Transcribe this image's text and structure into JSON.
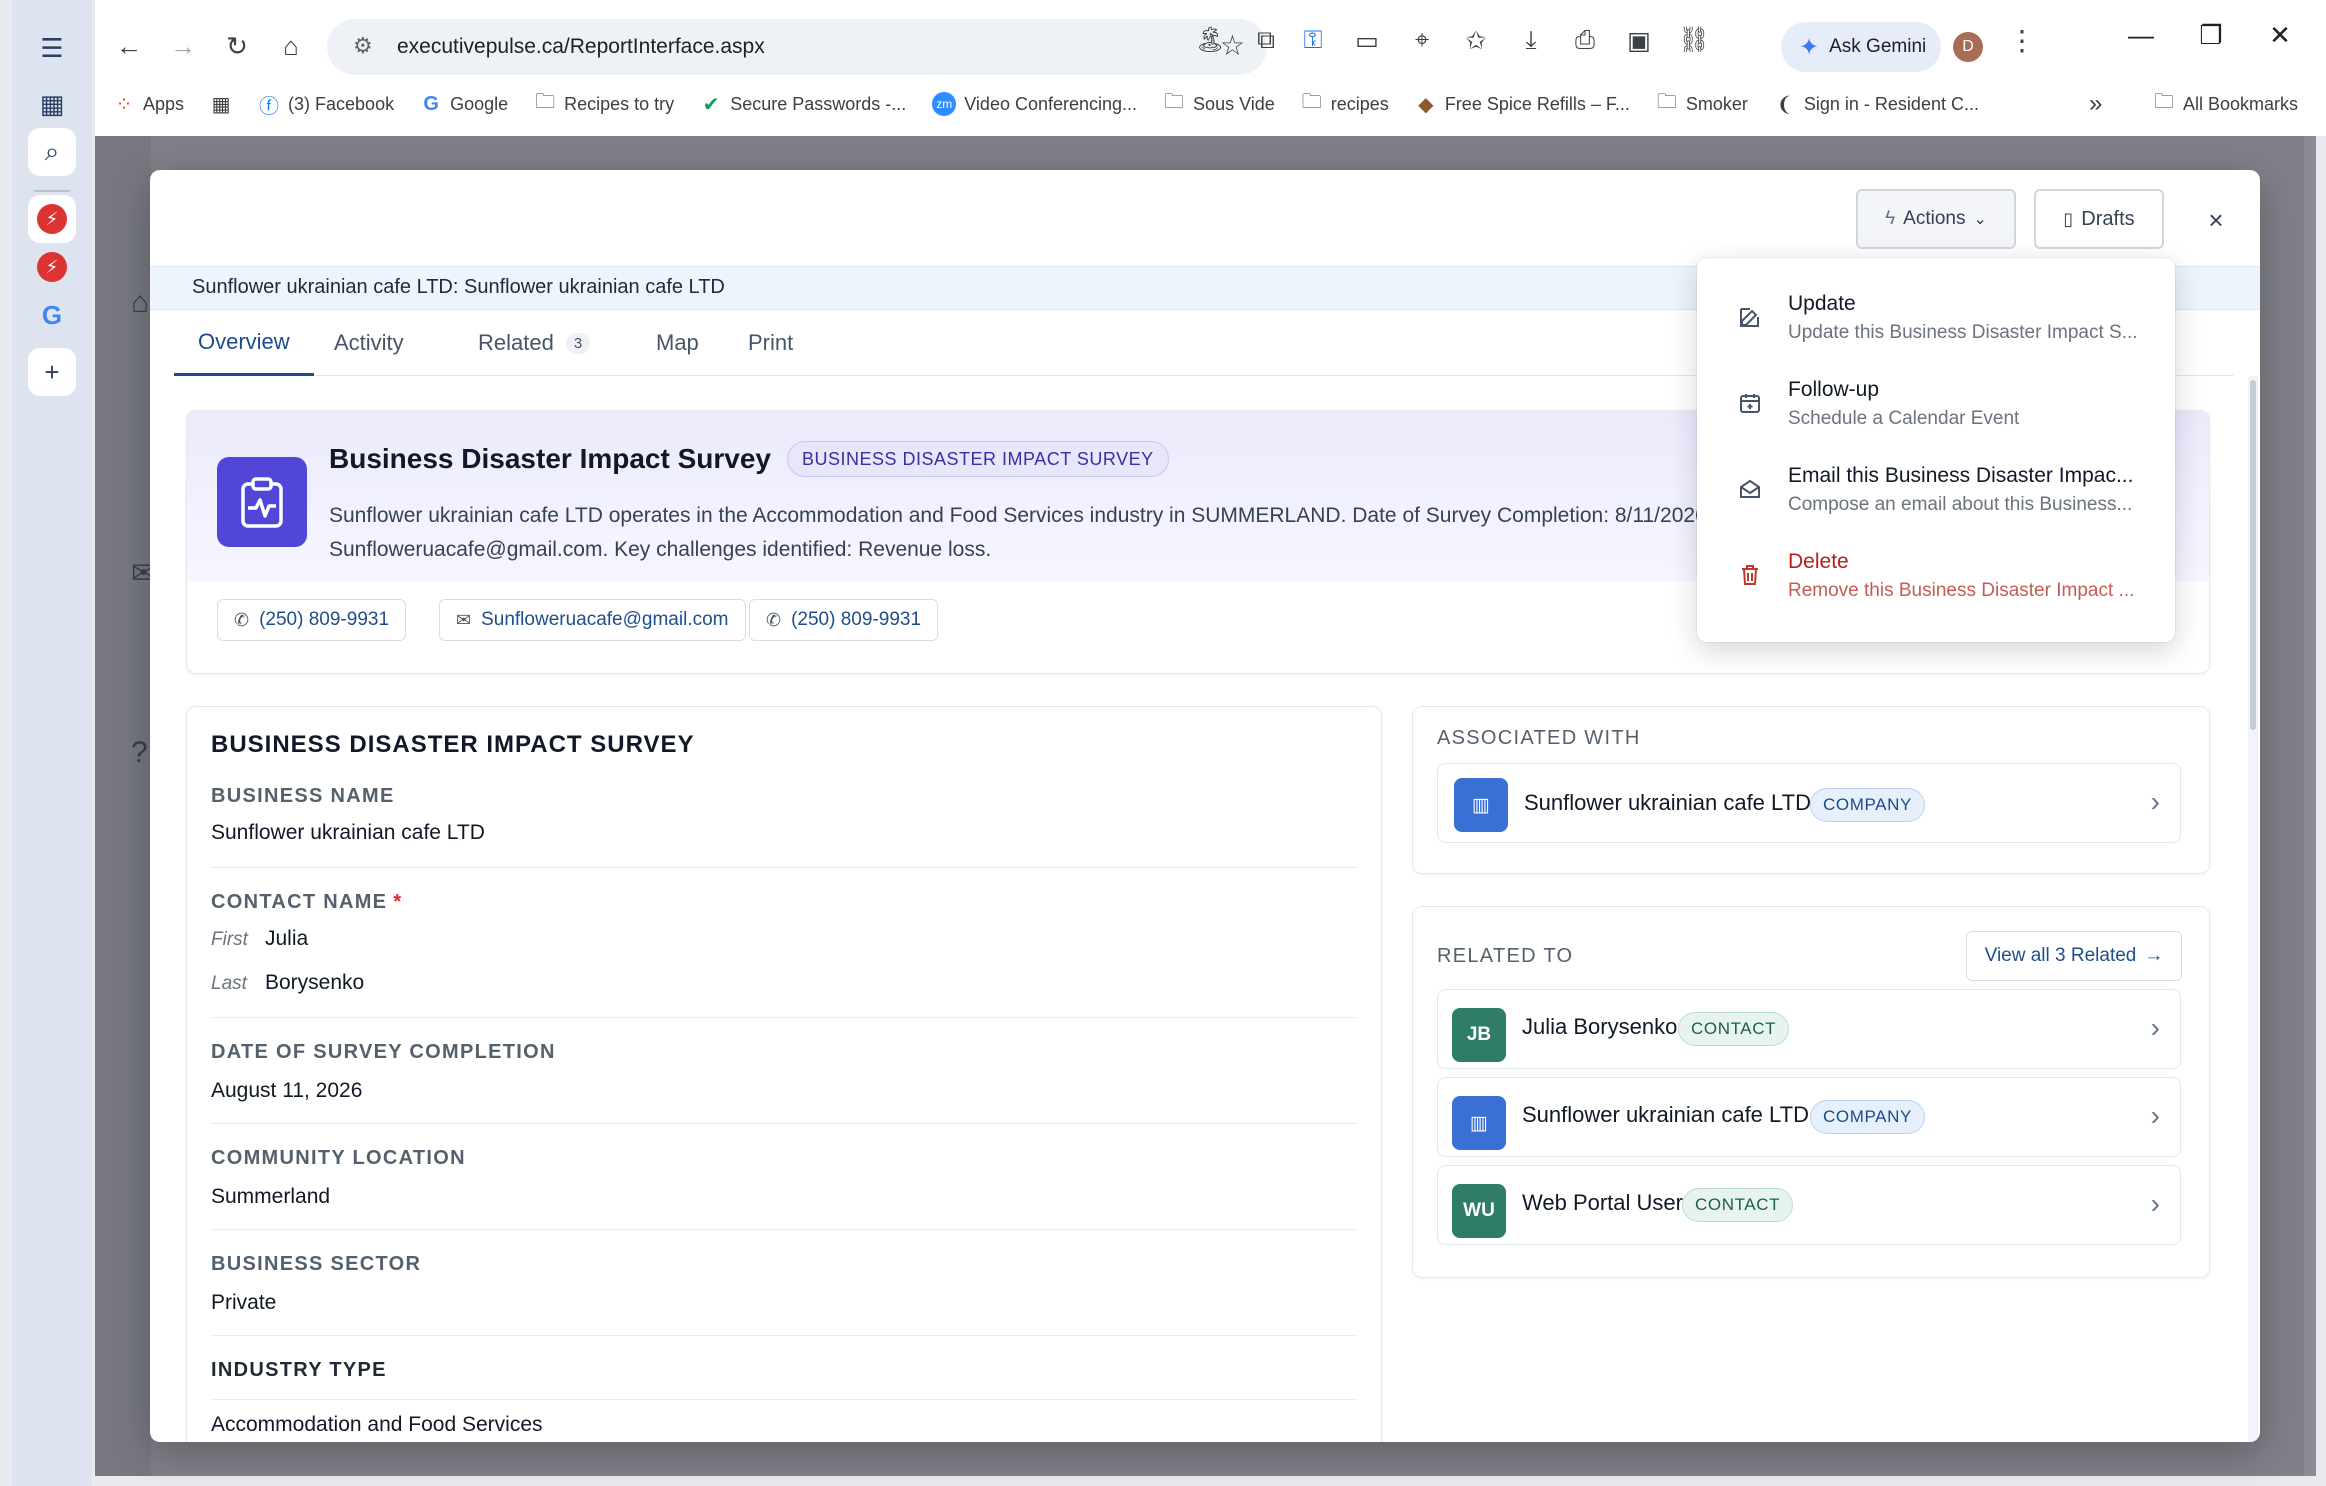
{
  "browser": {
    "url": "executivepulse.ca/ReportInterface.aspx",
    "gemini_label": "Ask Gemini",
    "profile_initial": "D",
    "bookmarks": [
      {
        "label": "Apps",
        "icon": "apps-grid-icon"
      },
      {
        "label": "",
        "icon": "grid-icon"
      },
      {
        "label": "(3) Facebook",
        "icon": "facebook-icon"
      },
      {
        "label": "Google",
        "icon": "google-icon"
      },
      {
        "label": "Recipes to try",
        "icon": "folder-icon"
      },
      {
        "label": "Secure Passwords -...",
        "icon": "check-icon"
      },
      {
        "label": "Video Conferencing...",
        "icon": "zoom-icon"
      },
      {
        "label": "Sous Vide",
        "icon": "folder-icon"
      },
      {
        "label": "recipes",
        "icon": "folder-icon"
      },
      {
        "label": "Free Spice Refills – F...",
        "icon": "spice-icon"
      },
      {
        "label": "Smoker",
        "icon": "folder-icon"
      },
      {
        "label": "Sign in - Resident C...",
        "icon": "resident-icon"
      }
    ],
    "all_bookmarks": "All Bookmarks"
  },
  "modal": {
    "actions_label": "Actions",
    "drafts_label": "Drafts",
    "record_title": "Sunflower ukrainian cafe LTD: Sunflower ukrainian cafe LTD",
    "tabs": [
      {
        "label": "Overview",
        "count": ""
      },
      {
        "label": "Activity",
        "count": ""
      },
      {
        "label": "Related",
        "count": "3"
      },
      {
        "label": "Map",
        "count": ""
      },
      {
        "label": "Print",
        "count": ""
      }
    ],
    "summary": {
      "title": "Business Disaster Impact Survey",
      "badge": "BUSINESS DISASTER IMPACT SURVEY",
      "description_line1": "Sunflower ukrainian cafe LTD operates in the Accommodation and Food Services industry in SUMMERLAND. Date of Survey Completion: 8/11/2026.",
      "description_line2": "Sunfloweruacafe@gmail.com. Key challenges identified: Revenue loss.",
      "chips": [
        "(250) 809-9931",
        "Sunfloweruacafe@gmail.com",
        "(250) 809-9931"
      ]
    },
    "form": {
      "heading": "BUSINESS DISASTER IMPACT SURVEY",
      "business_name_label": "BUSINESS NAME",
      "business_name": "Sunflower ukrainian cafe LTD",
      "contact_name_label": "CONTACT NAME",
      "required_mark": "*",
      "first_label": "First",
      "first_name": "Julia",
      "last_label": "Last",
      "last_name": "Borysenko",
      "date_label": "DATE OF SURVEY COMPLETION",
      "date_value": "August 11, 2026",
      "community_label": "COMMUNITY LOCATION",
      "community_value": "Summerland",
      "sector_label": "BUSINESS SECTOR",
      "sector_value": "Private",
      "industry_label": "INDUSTRY TYPE",
      "industry_value": "Accommodation and Food Services"
    },
    "associated": {
      "label": "ASSOCIATED WITH",
      "name": "Sunflower ukrainian cafe LTD",
      "tag": "COMPANY"
    },
    "related": {
      "label": "RELATED TO",
      "view_all": "View all 3 Related",
      "items": [
        {
          "initials": "JB",
          "name": "Julia Borysenko",
          "tag": "CONTACT"
        },
        {
          "initials": "",
          "name": "Sunflower ukrainian cafe LTD",
          "tag": "COMPANY"
        },
        {
          "initials": "WU",
          "name": "Web Portal User",
          "tag": "CONTACT"
        }
      ]
    }
  },
  "actions_menu": [
    {
      "title": "Update",
      "desc": "Update this Business Disaster Impact S..."
    },
    {
      "title": "Follow-up",
      "desc": "Schedule a Calendar Event"
    },
    {
      "title": "Email this Business Disaster Impac...",
      "desc": "Compose an email about this Business..."
    },
    {
      "title": "Delete",
      "desc": "Remove this Business Disaster Impact ..."
    }
  ],
  "colors": {
    "accent_blue": "#1d4b8f",
    "survey_icon_bg": "#5146d8",
    "company_avatar": "#3a6fd4",
    "contact_avatar": "#2f7d68",
    "danger": "#b91c1c"
  }
}
